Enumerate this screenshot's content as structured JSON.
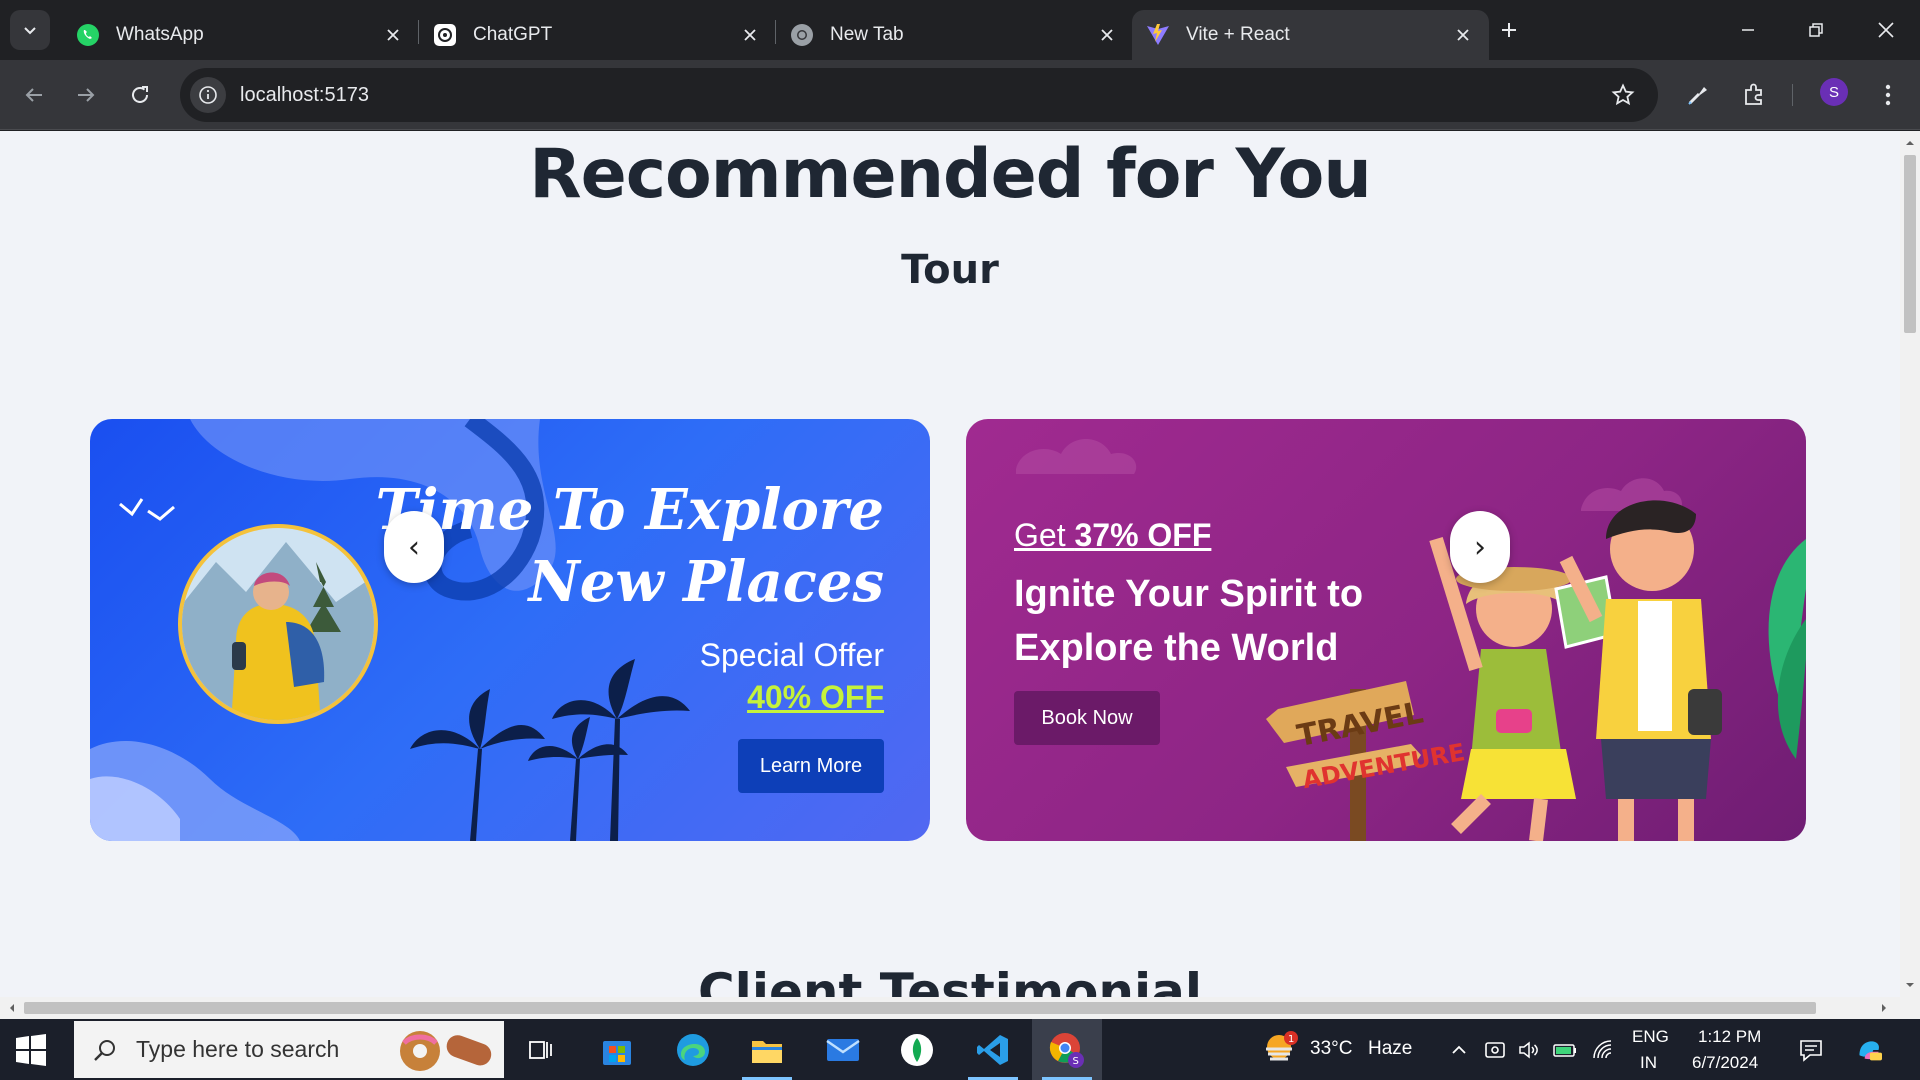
{
  "browser": {
    "tabs": [
      {
        "title": "WhatsApp",
        "icon": "whatsapp-icon",
        "active": false
      },
      {
        "title": "ChatGPT",
        "icon": "chatgpt-icon",
        "active": false
      },
      {
        "title": "New Tab",
        "icon": "chrome-icon",
        "active": false
      },
      {
        "title": "Vite + React",
        "icon": "vite-icon",
        "active": true
      }
    ],
    "url": "localhost:5173",
    "profile_initial": "S"
  },
  "page": {
    "heading": "Recommended for You",
    "subheading": "Tour",
    "next_heading": "Client Testimonial",
    "prev_arrow": "‹",
    "next_arrow": "›",
    "cards": [
      {
        "title_line1": "Time To Explore",
        "title_line2": "New Places",
        "offer_label": "Special Offer",
        "offer_value": "40% OFF",
        "button": "Learn More"
      },
      {
        "get_prefix": "Get ",
        "discount": "37% OFF",
        "title_line1": "Ignite Your Spirit to",
        "title_line2": "Explore the World",
        "button": "Book Now",
        "sign_top": "TRAVEL",
        "sign_bottom": "ADVENTURE"
      }
    ]
  },
  "taskbar": {
    "search_placeholder": "Type here to search",
    "weather_temp": "33°C",
    "weather_desc": "Haze",
    "weather_badge": "1",
    "lang_line1": "ENG",
    "lang_line2": "IN",
    "time": "1:12 PM",
    "date": "6/7/2024"
  },
  "colors": {
    "accent_offer": "#c5f23b",
    "blue_card": "#2e6df7",
    "purple_card": "#8d2585"
  }
}
